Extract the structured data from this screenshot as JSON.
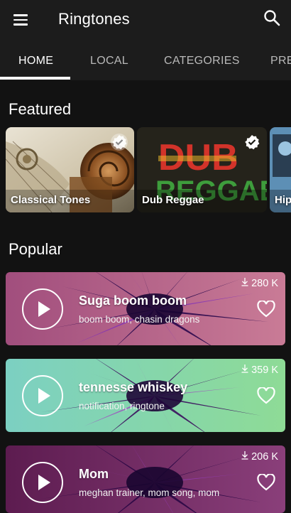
{
  "app": {
    "title": "Ringtones"
  },
  "icons": {
    "menu": "menu-icon",
    "search": "search-icon",
    "verified": "verified-badge-icon",
    "play": "play-icon",
    "heart": "heart-outline-icon",
    "download": "download-icon"
  },
  "tabs": [
    {
      "label": "HOME",
      "active": true
    },
    {
      "label": "LOCAL",
      "active": false
    },
    {
      "label": "CATEGORIES",
      "active": false
    },
    {
      "label": "PRE",
      "active": false
    }
  ],
  "featured": {
    "heading": "Featured",
    "items": [
      {
        "label": "Classical Tones",
        "verified": true
      },
      {
        "label": "Dub Reggae",
        "verified": true,
        "artwork_text_top": "DUB",
        "artwork_text_bottom": "REGGAE"
      },
      {
        "label": "Hip",
        "verified": false
      }
    ]
  },
  "popular": {
    "heading": "Popular",
    "items": [
      {
        "title": "Suga boom boom",
        "tags": "boom boom, chasin dragons",
        "downloads": "280 K",
        "colors": [
          "#a14e7d",
          "#c97b96"
        ]
      },
      {
        "title": "tennesse whiskey",
        "tags": "notification, ringtone",
        "downloads": "359 K",
        "colors": [
          "#7cd0c2",
          "#8edb96"
        ]
      },
      {
        "title": "Mom",
        "tags": "meghan trainer, mom song, mom",
        "downloads": "206 K",
        "colors": [
          "#5d1c50",
          "#8a3f7a"
        ]
      }
    ]
  },
  "colors": {
    "background": "#121212",
    "appbar": "#1c1c1c",
    "accent": "#ffffff"
  }
}
